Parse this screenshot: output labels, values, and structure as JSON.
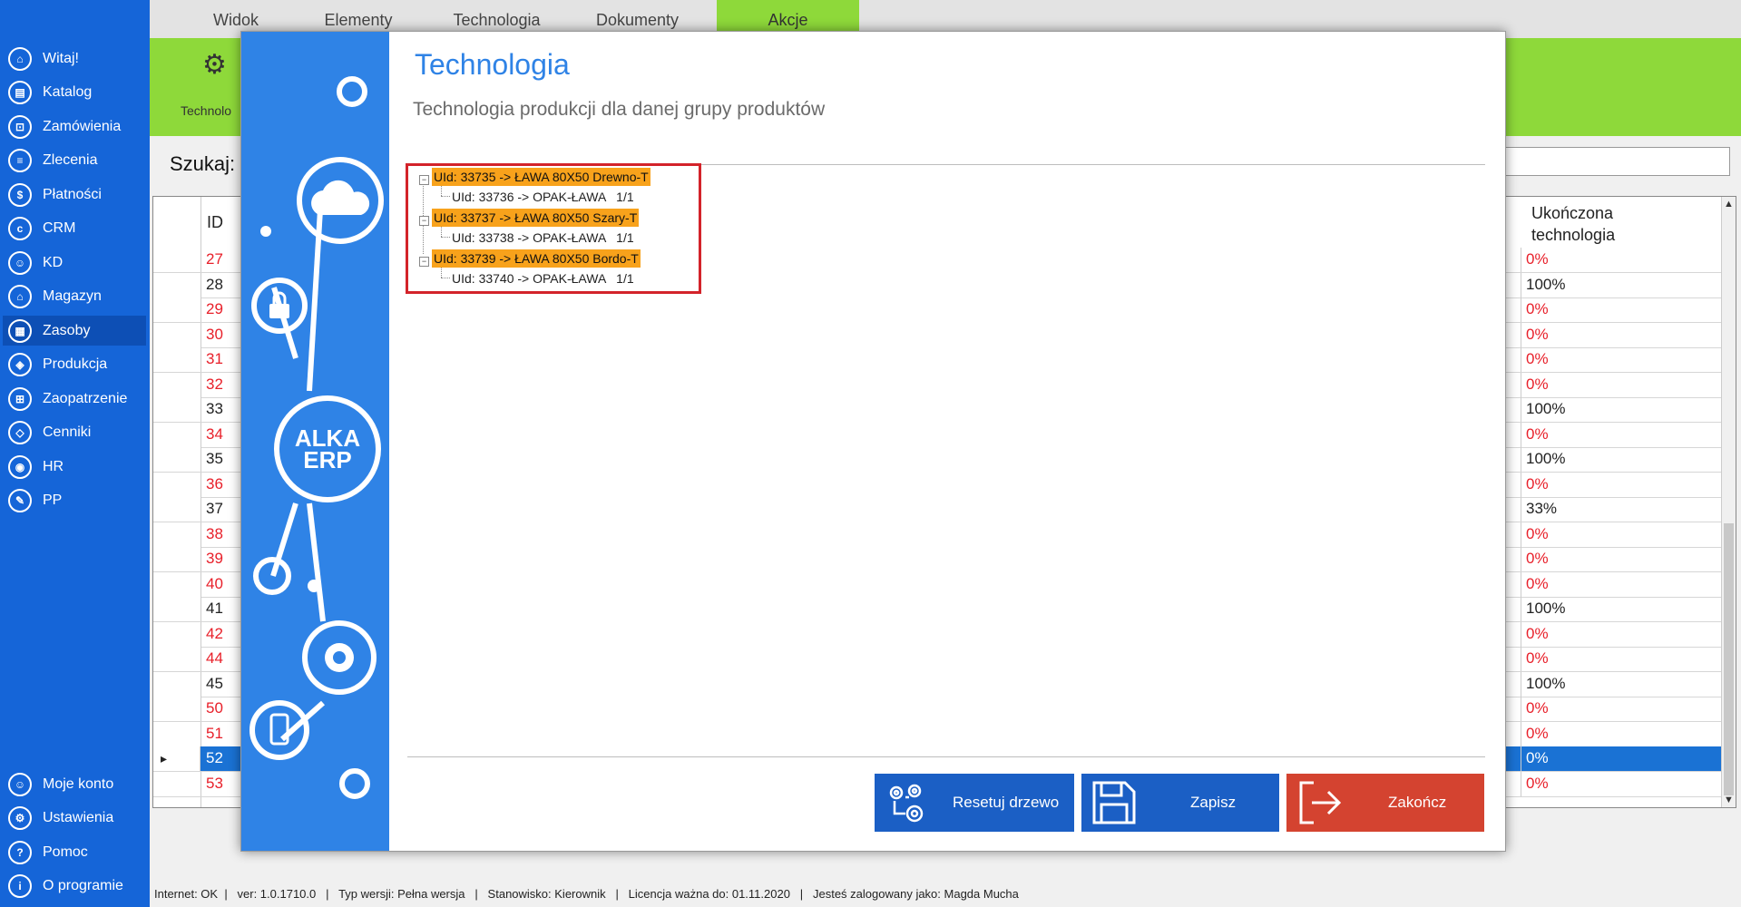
{
  "sidebar": {
    "items": [
      {
        "label": "Witaj!",
        "icon": "home-icon",
        "glyph": "⌂"
      },
      {
        "label": "Katalog",
        "icon": "book-icon",
        "glyph": "▤"
      },
      {
        "label": "Zamówienia",
        "icon": "cart-icon",
        "glyph": "⊡"
      },
      {
        "label": "Zlecenia",
        "icon": "list-icon",
        "glyph": "≡"
      },
      {
        "label": "Płatności",
        "icon": "dollar-icon",
        "glyph": "$"
      },
      {
        "label": "CRM",
        "icon": "crm-icon",
        "glyph": "c"
      },
      {
        "label": "KD",
        "icon": "person-icon",
        "glyph": "☺"
      },
      {
        "label": "Magazyn",
        "icon": "warehouse-icon",
        "glyph": "⌂"
      },
      {
        "label": "Zasoby",
        "icon": "resources-icon",
        "glyph": "▦"
      },
      {
        "label": "Produkcja",
        "icon": "production-icon",
        "glyph": "◈"
      },
      {
        "label": "Zaopatrzenie",
        "icon": "truck-icon",
        "glyph": "⊞"
      },
      {
        "label": "Cenniki",
        "icon": "tag-icon",
        "glyph": "◇"
      },
      {
        "label": "HR",
        "icon": "hr-icon",
        "glyph": "◉"
      },
      {
        "label": "PP",
        "icon": "pp-icon",
        "glyph": "✎"
      }
    ],
    "bottom_items": [
      {
        "label": "Moje konto",
        "icon": "account-icon",
        "glyph": "☺"
      },
      {
        "label": "Ustawienia",
        "icon": "settings-icon",
        "glyph": "⚙"
      },
      {
        "label": "Pomoc",
        "icon": "help-icon",
        "glyph": "?"
      },
      {
        "label": "O programie",
        "icon": "info-icon",
        "glyph": "i"
      }
    ],
    "active": "Zasoby"
  },
  "top_menu": {
    "tabs": [
      "Widok",
      "Elementy",
      "Technologia",
      "Dokumenty",
      "Akcje"
    ],
    "active": "Akcje"
  },
  "ribbon": {
    "label": "Technolo"
  },
  "search": {
    "label": "Szukaj:"
  },
  "grid": {
    "col_id": "ID",
    "col_tech": "Ukończona technologia",
    "rows": [
      {
        "id": "27",
        "pct": "0%"
      },
      {
        "id": "28",
        "pct": "100%"
      },
      {
        "id": "29",
        "pct": "0%"
      },
      {
        "id": "30",
        "pct": "0%"
      },
      {
        "id": "31",
        "pct": "0%"
      },
      {
        "id": "32",
        "pct": "0%"
      },
      {
        "id": "33",
        "pct": "100%"
      },
      {
        "id": "34",
        "pct": "0%"
      },
      {
        "id": "35",
        "pct": "100%"
      },
      {
        "id": "36",
        "pct": "0%"
      },
      {
        "id": "37",
        "pct": "33%"
      },
      {
        "id": "38",
        "pct": "0%"
      },
      {
        "id": "39",
        "pct": "0%"
      },
      {
        "id": "40",
        "pct": "0%"
      },
      {
        "id": "41",
        "pct": "100%"
      },
      {
        "id": "42",
        "pct": "0%"
      },
      {
        "id": "44",
        "pct": "0%"
      },
      {
        "id": "45",
        "pct": "100%"
      },
      {
        "id": "50",
        "pct": "0%"
      },
      {
        "id": "51",
        "pct": "0%"
      },
      {
        "id": "52",
        "pct": "0%"
      },
      {
        "id": "53",
        "pct": "0%"
      }
    ],
    "selected_id": "52"
  },
  "modal": {
    "title": "Technologia",
    "subtitle": "Technologia produkcji dla danej grupy produktów",
    "logo": "ALKA ERP",
    "tree": [
      {
        "label": "UId: 33735 -> ŁAWA 80X50 Drewno-T",
        "child": "UId: 33736 -> OPAK-ŁAWA   1/1"
      },
      {
        "label": "UId: 33737 -> ŁAWA 80X50 Szary-T",
        "child": "UId: 33738 -> OPAK-ŁAWA   1/1"
      },
      {
        "label": "UId: 33739 -> ŁAWA 80X50 Bordo-T",
        "child": "UId: 33740 -> OPAK-ŁAWA   1/1"
      }
    ],
    "buttons": {
      "reset": "Resetuj drzewo",
      "save": "Zapisz",
      "end": "Zakończ"
    }
  },
  "status": {
    "text": "Internet: OK  |   ver: 1.0.1710.0   |   Typ wersji: Pełna wersja   |   Stanowisko: Kierownik   |   Licencja ważna do: 01.11.2020   |   Jesteś zalogowany jako: Magda Mucha"
  },
  "colors": {
    "sidebar": "#1565d8",
    "ribbon": "#8ed93a",
    "modal_side": "#2f83e6",
    "tree_parent": "#f8a21b",
    "end_button": "#d44330",
    "accent_red": "#e8202a"
  }
}
